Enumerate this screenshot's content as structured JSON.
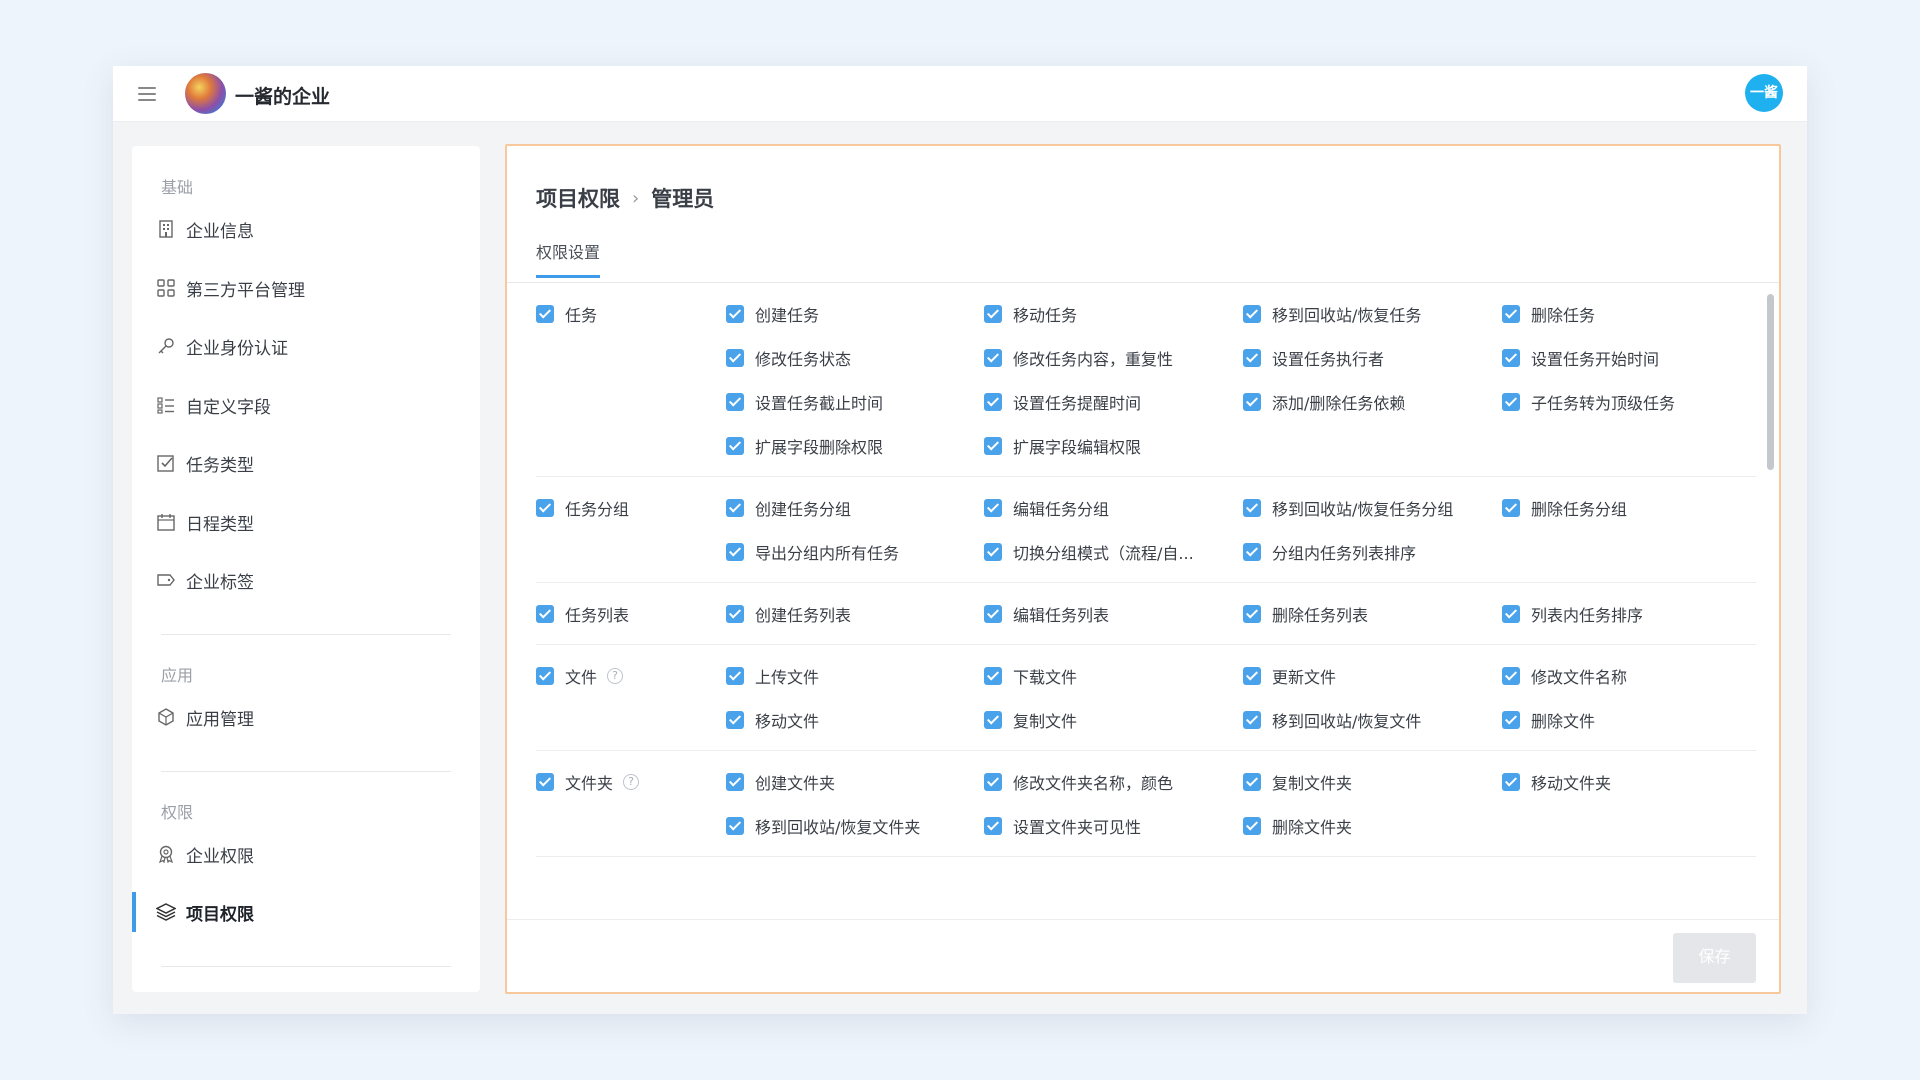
{
  "topbar": {
    "org_name": "一酱的企业",
    "user_avatar_text": "一酱"
  },
  "sidebar": {
    "groups": [
      "基础",
      "应用",
      "权限"
    ],
    "items": [
      {
        "label": "企业信息"
      },
      {
        "label": "第三方平台管理"
      },
      {
        "label": "企业身份认证"
      },
      {
        "label": "自定义字段"
      },
      {
        "label": "任务类型"
      },
      {
        "label": "日程类型"
      },
      {
        "label": "企业标签"
      },
      {
        "label": "应用管理"
      },
      {
        "label": "企业权限"
      },
      {
        "label": "项目权限",
        "active": true
      }
    ]
  },
  "main": {
    "breadcrumb": [
      "项目权限",
      "管理员"
    ],
    "tab": "权限设置",
    "save_label": "保存",
    "sections": [
      {
        "title": "任务",
        "items": [
          "创建任务",
          "移动任务",
          "移到回收站/恢复任务",
          "删除任务",
          "修改任务状态",
          "修改任务内容，重复性",
          "设置任务执行者",
          "设置任务开始时间",
          "设置任务截止时间",
          "设置任务提醒时间",
          "添加/删除任务依赖",
          "子任务转为顶级任务",
          "扩展字段删除权限",
          "扩展字段编辑权限"
        ]
      },
      {
        "title": "任务分组",
        "items": [
          "创建任务分组",
          "编辑任务分组",
          "移到回收站/恢复任务分组",
          "删除任务分组",
          "导出分组内所有任务",
          "切换分组模式（流程/自...",
          "分组内任务列表排序"
        ]
      },
      {
        "title": "任务列表",
        "items": [
          "创建任务列表",
          "编辑任务列表",
          "删除任务列表",
          "列表内任务排序"
        ]
      },
      {
        "title": "文件",
        "help": true,
        "items": [
          "上传文件",
          "下载文件",
          "更新文件",
          "修改文件名称",
          "移动文件",
          "复制文件",
          "移到回收站/恢复文件",
          "删除文件"
        ]
      },
      {
        "title": "文件夹",
        "help": true,
        "items": [
          "创建文件夹",
          "修改文件夹名称，颜色",
          "复制文件夹",
          "移动文件夹",
          "移到回收站/恢复文件夹",
          "设置文件夹可见性",
          "删除文件夹"
        ]
      }
    ]
  },
  "colors": {
    "accent": "#3d9be9",
    "checkbox": "#4aa3ea",
    "highlight_border": "#f6c89c"
  }
}
